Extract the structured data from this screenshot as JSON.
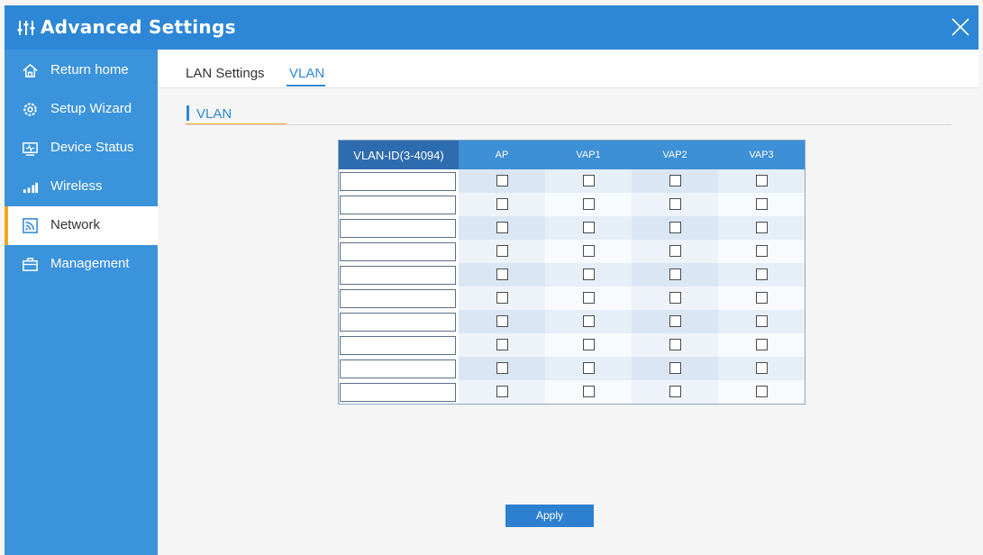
{
  "window": {
    "title": "Advanced Settings"
  },
  "sidebar": {
    "items": [
      {
        "label": "Return home",
        "icon": "home-icon"
      },
      {
        "label": "Setup Wizard",
        "icon": "gear-icon"
      },
      {
        "label": "Device Status",
        "icon": "monitor-icon"
      },
      {
        "label": "Wireless",
        "icon": "signal-icon"
      },
      {
        "label": "Network",
        "icon": "network-icon",
        "active": true
      },
      {
        "label": "Management",
        "icon": "toolbox-icon"
      }
    ]
  },
  "tabs": [
    {
      "label": "LAN Settings",
      "active": false
    },
    {
      "label": "VLAN",
      "active": true
    }
  ],
  "section": {
    "title": "VLAN"
  },
  "table": {
    "columns": [
      "VLAN-ID(3-4094)",
      "AP",
      "VAP1",
      "VAP2",
      "VAP3"
    ],
    "rows": [
      {
        "vlan_id": "",
        "checks": [
          false,
          false,
          false,
          false
        ]
      },
      {
        "vlan_id": "",
        "checks": [
          false,
          false,
          false,
          false
        ]
      },
      {
        "vlan_id": "",
        "checks": [
          false,
          false,
          false,
          false
        ]
      },
      {
        "vlan_id": "",
        "checks": [
          false,
          false,
          false,
          false
        ]
      },
      {
        "vlan_id": "",
        "checks": [
          false,
          false,
          false,
          false
        ]
      },
      {
        "vlan_id": "",
        "checks": [
          false,
          false,
          false,
          false
        ]
      },
      {
        "vlan_id": "",
        "checks": [
          false,
          false,
          false,
          false
        ]
      },
      {
        "vlan_id": "",
        "checks": [
          false,
          false,
          false,
          false
        ]
      },
      {
        "vlan_id": "",
        "checks": [
          false,
          false,
          false,
          false
        ]
      },
      {
        "vlan_id": "",
        "checks": [
          false,
          false,
          false,
          false
        ]
      }
    ]
  },
  "actions": {
    "apply_label": "Apply"
  },
  "colors": {
    "title_bar": "#2d87d6",
    "sidebar": "#3b93dc",
    "active_indicator": "#f5a623",
    "accent": "#2d87d6"
  }
}
